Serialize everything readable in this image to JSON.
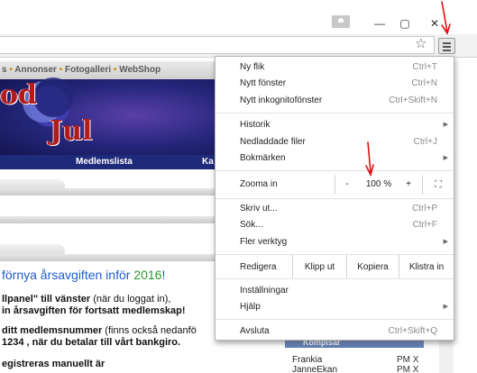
{
  "browser": {
    "window_controls": {
      "minimize": "—",
      "maximize": "▢",
      "close": "✕"
    }
  },
  "page": {
    "nav_links": [
      "s",
      "Annonser",
      "Fotogalleri",
      "WebShop"
    ],
    "banner": {
      "line1": "od",
      "line2": "Jul"
    },
    "member_nav": {
      "item1": "Medlemslista",
      "item2": "Ka"
    },
    "headline": {
      "text": "förnya årsavgiften inför",
      "year": "2016",
      "suffix": "!"
    },
    "body": [
      {
        "bold": "llpanel\" till vänster",
        "rest": " (när du loggat in),"
      },
      {
        "bold": "in årsavgiften för fortsatt medlemskap!",
        "rest": ""
      },
      {
        "bold": "ditt medlemsnummer",
        "rest": " (finns också nedanfö"
      },
      {
        "bold": "1234 , när du betalar till vårt bankgiro.",
        "rest": ""
      },
      {
        "bold": "egistreras manuellt är",
        "rest": ""
      }
    ],
    "side_panel": {
      "header": "Kompisar",
      "rows": [
        {
          "name": "Frankia",
          "status": "PM X"
        },
        {
          "name": "JanneEkan",
          "status": "PM X"
        }
      ]
    }
  },
  "menu": {
    "items": [
      {
        "label": "Ny flik",
        "shortcut": "Ctrl+T"
      },
      {
        "label": "Nytt fönster",
        "shortcut": "Ctrl+N"
      },
      {
        "label": "Nytt inkognitofönster",
        "shortcut": "Ctrl+Skift+N"
      },
      {
        "label": "Historik",
        "shortcut": ""
      },
      {
        "label": "Nedladdade filer",
        "shortcut": "Ctrl+J"
      },
      {
        "label": "Bokmärken",
        "shortcut": ""
      },
      {
        "label": "Skriv ut...",
        "shortcut": "Ctrl+P"
      },
      {
        "label": "Sök...",
        "shortcut": "Ctrl+F"
      },
      {
        "label": "Fler verktyg",
        "shortcut": ""
      },
      {
        "label": "Inställningar",
        "shortcut": ""
      },
      {
        "label": "Hjälp",
        "shortcut": ""
      },
      {
        "label": "Avsluta",
        "shortcut": "Ctrl+Skift+Q"
      }
    ],
    "zoom": {
      "label": "Zooma in",
      "minus": "-",
      "value": "100 %",
      "plus": "+"
    },
    "edit": {
      "label": "Redigera",
      "cut": "Klipp ut",
      "copy": "Kopiera",
      "paste": "Klistra in"
    }
  },
  "colors": {
    "annotation": "#e01010",
    "banner_blue": "#24267a",
    "headline_blue": "#1f5cc9",
    "headline_green": "#2a9a2a"
  }
}
